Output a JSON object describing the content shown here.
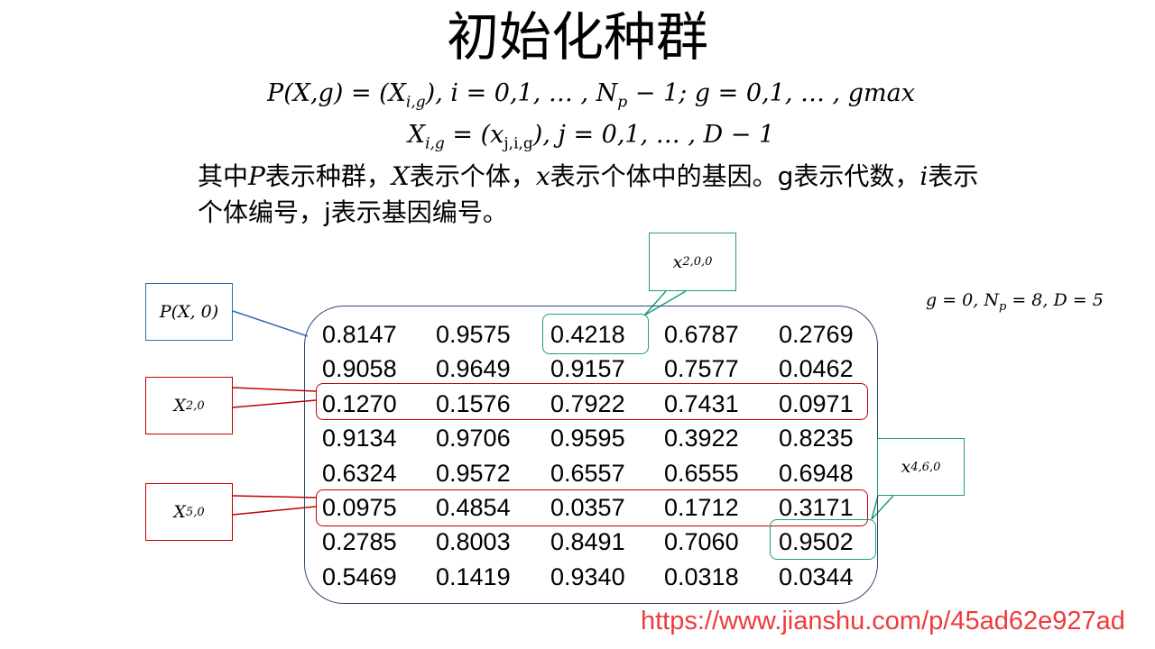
{
  "title": "初始化种群",
  "formula_1": {
    "lhs": "P(X,g) = (X",
    "sub1": "i,g",
    "mid": "), i = 0,1, … , N",
    "sub2": "p",
    "rhs": " − 1; g = 0,1, … , gmax"
  },
  "formula_2": {
    "lhs": "X",
    "sub1": "i,g",
    "mid": " = (x",
    "sub2": "j,i,g",
    "rhs": "), j = 0,1, … , D − 1"
  },
  "description": {
    "part1": "其中",
    "var_p": "P",
    "part2": "表示种群，",
    "var_x_upper": "X",
    "part3": "表示个体，",
    "var_x_lower": "x",
    "part4": "表示个体中的基因。g表示代数，",
    "var_i": "i",
    "part5": "表示个体编号，j表示基因编号。"
  },
  "matrix": [
    [
      "0.8147",
      "0.9575",
      "0.4218",
      "0.6787",
      "0.2769"
    ],
    [
      "0.9058",
      "0.9649",
      "0.9157",
      "0.7577",
      "0.0462"
    ],
    [
      "0.1270",
      "0.1576",
      "0.7922",
      "0.7431",
      "0.0971"
    ],
    [
      "0.9134",
      "0.9706",
      "0.9595",
      "0.3922",
      "0.8235"
    ],
    [
      "0.6324",
      "0.9572",
      "0.6557",
      "0.6555",
      "0.6948"
    ],
    [
      "0.0975",
      "0.4854",
      "0.0357",
      "0.1712",
      "0.3171"
    ],
    [
      "0.2785",
      "0.8003",
      "0.8491",
      "0.7060",
      "0.9502"
    ],
    [
      "0.5469",
      "0.1419",
      "0.9340",
      "0.0318",
      "0.0344"
    ]
  ],
  "callouts": {
    "population": "P(X, 0)",
    "individual_2": {
      "base": "X",
      "sub": "2,0"
    },
    "individual_5": {
      "base": "X",
      "sub": "5,0"
    },
    "gene_200": {
      "base": "x",
      "sub": "2,0,0"
    },
    "gene_460": {
      "base": "x",
      "sub": "4,6,0"
    }
  },
  "params": {
    "part1": "g = 0, N",
    "sub": "p",
    "part2": " = 8, D = 5"
  },
  "watermark": "https://www.jianshu.com/p/45ad62e927ad",
  "colors": {
    "matrix_border": "#2e4a6b",
    "population_callout": "#2e6fb0",
    "individual_highlight": "#c00000",
    "gene_highlight": "#1d9e74",
    "watermark": "#ee3b3b"
  }
}
